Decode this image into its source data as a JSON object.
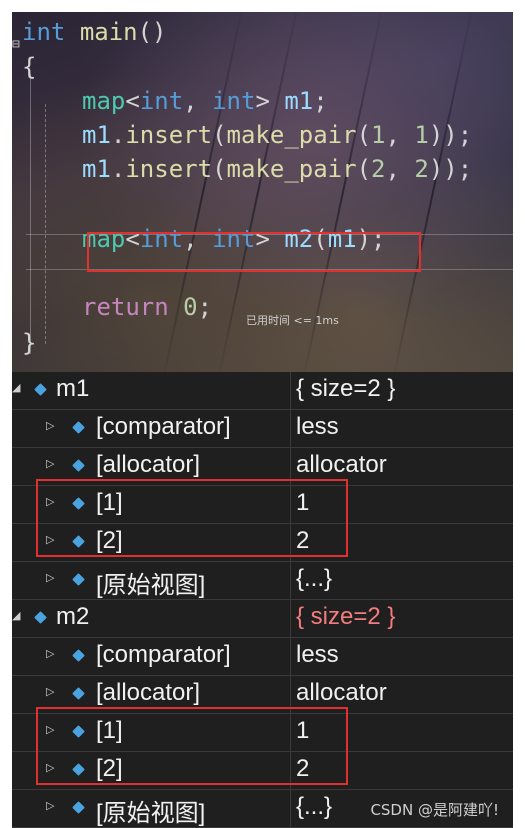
{
  "editor": {
    "line1": {
      "kw": "int",
      "fn": "main",
      "rest": "()"
    },
    "open_brace": "{",
    "close_brace": "}",
    "line3": {
      "ty": "map",
      "lt": "<",
      "t1": "int",
      "comma": ", ",
      "t2": "int",
      "gt": ">",
      "var": "m1",
      "end": ";"
    },
    "line4": {
      "var": "m1",
      "dot": ".",
      "fn": "insert",
      "p1": "(",
      "fn2": "make_pair",
      "p2": "(",
      "n1": "1",
      "c": ", ",
      "n2": "1",
      "end": "));"
    },
    "line5": {
      "var": "m1",
      "dot": ".",
      "fn": "insert",
      "p1": "(",
      "fn2": "make_pair",
      "p2": "(",
      "n1": "2",
      "c": ", ",
      "n2": "2",
      "end": "));"
    },
    "line7": {
      "ty": "map",
      "lt": "<",
      "t1": "int",
      "comma": ", ",
      "t2": "int",
      "gt": ">",
      "var": "m2",
      "p1": "(",
      "arg": "m1",
      "end": ");"
    },
    "line9": {
      "kw": "return",
      "num": "0",
      "end": ";"
    },
    "perf_tip": "已用时间 <= 1ms"
  },
  "watch": {
    "rows": [
      {
        "name": "m1",
        "value": "{ size=2 }"
      },
      {
        "name": "[comparator]",
        "value": "less"
      },
      {
        "name": "[allocator]",
        "value": "allocator"
      },
      {
        "name": "[1]",
        "value": "1"
      },
      {
        "name": "[2]",
        "value": "2"
      },
      {
        "name": "[原始视图]",
        "value": "{...}"
      },
      {
        "name": "m2",
        "value": "{ size=2 }"
      },
      {
        "name": "[comparator]",
        "value": "less"
      },
      {
        "name": "[allocator]",
        "value": "allocator"
      },
      {
        "name": "[1]",
        "value": "1"
      },
      {
        "name": "[2]",
        "value": "2"
      },
      {
        "name": "[原始视图]",
        "value": "{...}"
      }
    ],
    "colors": {
      "changed": "#f47c7c",
      "highlight_box": "#e03030",
      "object_icon": "#4aa3df"
    }
  },
  "watermark": "CSDN @是阿建吖!"
}
